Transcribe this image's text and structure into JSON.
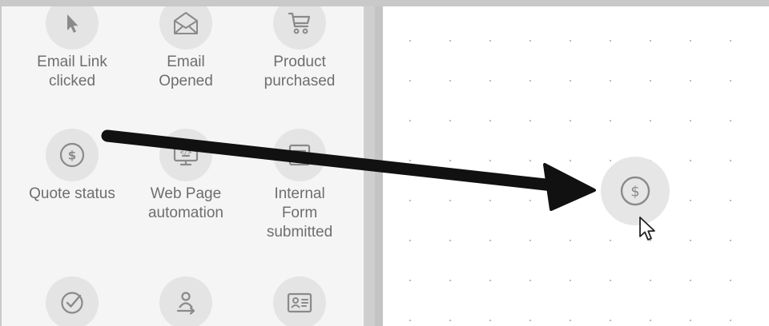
{
  "palette": {
    "triggers": [
      {
        "id": "email-link-clicked",
        "icon": "cursor-arrow-icon",
        "line1": "Email Link",
        "line2": "clicked",
        "line3": ""
      },
      {
        "id": "email-opened",
        "icon": "envelope-open-icon",
        "line1": "Email",
        "line2": "Opened",
        "line3": ""
      },
      {
        "id": "product-purchased",
        "icon": "shopping-cart-icon",
        "line1": "Product",
        "line2": "purchased",
        "line3": ""
      },
      {
        "id": "quote-status",
        "icon": "dollar-coin-icon",
        "line1": "Quote status",
        "line2": "",
        "line3": ""
      },
      {
        "id": "web-page-automation",
        "icon": "code-monitor-icon",
        "line1": "Web Page",
        "line2": "automation",
        "line3": ""
      },
      {
        "id": "internal-form-submitted",
        "icon": "form-icon",
        "line1": "Internal",
        "line2": "Form",
        "line3": "submitted"
      },
      {
        "id": "row3-item1",
        "icon": "check-circle-icon",
        "line1": "",
        "line2": "",
        "line3": ""
      },
      {
        "id": "row3-item2",
        "icon": "person-arrow-icon",
        "line1": "",
        "line2": "",
        "line3": ""
      },
      {
        "id": "row3-item3",
        "icon": "contact-card-icon",
        "line1": "",
        "line2": "",
        "line3": ""
      }
    ]
  },
  "canvas": {
    "dropped_node": {
      "icon": "dollar-coin-icon"
    }
  },
  "colors": {
    "palette_bg": "#f5f5f5",
    "icon_circle": "#e4e4e4",
    "icon_stroke": "#8a8a8a",
    "label_text": "#6e6e6e",
    "arrow": "#111111"
  }
}
